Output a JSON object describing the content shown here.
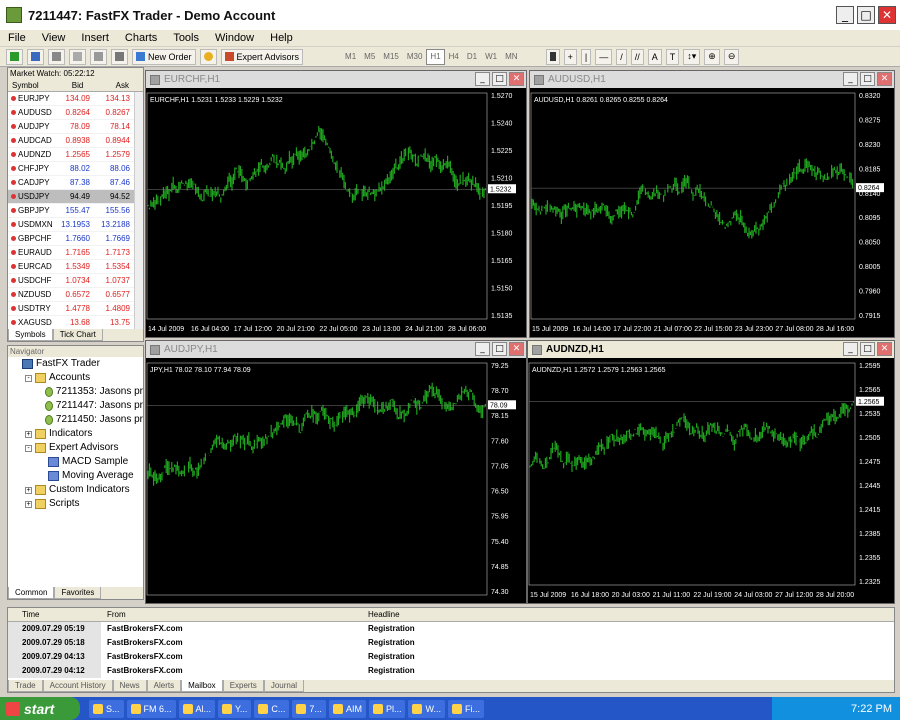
{
  "window": {
    "title": "7211447: FastFX Trader - Demo Account"
  },
  "menu": [
    "File",
    "View",
    "Insert",
    "Charts",
    "Tools",
    "Window",
    "Help"
  ],
  "toolbar": {
    "new_order": "New Order",
    "expert_advisors": "Expert Advisors",
    "timeframes": [
      "M1",
      "M5",
      "M15",
      "M30",
      "H1",
      "H4",
      "D1",
      "W1",
      "MN"
    ],
    "active_tf": "H1"
  },
  "market_watch": {
    "title": "Market Watch: 05:22:12",
    "columns": [
      "Symbol",
      "Bid",
      "Ask"
    ],
    "rows": [
      {
        "symbol": "EURJPY",
        "bid": "134.09",
        "ask": "134.13",
        "dir": "dn"
      },
      {
        "symbol": "AUDUSD",
        "bid": "0.8264",
        "ask": "0.8267",
        "dir": "dn"
      },
      {
        "symbol": "AUDJPY",
        "bid": "78.09",
        "ask": "78.14",
        "dir": "dn"
      },
      {
        "symbol": "AUDCAD",
        "bid": "0.8938",
        "ask": "0.8944",
        "dir": "dn"
      },
      {
        "symbol": "AUDNZD",
        "bid": "1.2565",
        "ask": "1.2579",
        "dir": "dn"
      },
      {
        "symbol": "CHFJPY",
        "bid": "88.02",
        "ask": "88.06",
        "dir": "up"
      },
      {
        "symbol": "CADJPY",
        "bid": "87.38",
        "ask": "87.46",
        "dir": "up"
      },
      {
        "symbol": "USDJPY",
        "bid": "94.49",
        "ask": "94.52",
        "dir": "sel"
      },
      {
        "symbol": "GBPJPY",
        "bid": "155.47",
        "ask": "155.56",
        "dir": "up"
      },
      {
        "symbol": "USDMXN",
        "bid": "13.1953",
        "ask": "13.2188",
        "dir": "up"
      },
      {
        "symbol": "GBPCHF",
        "bid": "1.7660",
        "ask": "1.7669",
        "dir": "up"
      },
      {
        "symbol": "EURAUD",
        "bid": "1.7165",
        "ask": "1.7173",
        "dir": "dn"
      },
      {
        "symbol": "EURCAD",
        "bid": "1.5349",
        "ask": "1.5354",
        "dir": "dn"
      },
      {
        "symbol": "USDCHF",
        "bid": "1.0734",
        "ask": "1.0737",
        "dir": "dn"
      },
      {
        "symbol": "NZDUSD",
        "bid": "0.6572",
        "ask": "0.6577",
        "dir": "dn"
      },
      {
        "symbol": "USDTRY",
        "bid": "1.4778",
        "ask": "1.4809",
        "dir": "dn"
      },
      {
        "symbol": "XAGUSD",
        "bid": "13.68",
        "ask": "13.75",
        "dir": "dn"
      }
    ],
    "tabs": [
      "Symbols",
      "Tick Chart"
    ]
  },
  "navigator": {
    "title": "Navigator",
    "items": [
      {
        "label": "FastFX Trader",
        "level": 0,
        "icon": "app-icon",
        "expand": ""
      },
      {
        "label": "Accounts",
        "level": 1,
        "icon": "folder-icon",
        "expand": "-"
      },
      {
        "label": "7211353: Jasons pr",
        "level": 2,
        "icon": "account-icon",
        "expand": ""
      },
      {
        "label": "7211447: Jasons pr",
        "level": 2,
        "icon": "account-icon",
        "expand": ""
      },
      {
        "label": "7211450: Jasons pr",
        "level": 2,
        "icon": "account-icon",
        "expand": ""
      },
      {
        "label": "Indicators",
        "level": 1,
        "icon": "folder-icon",
        "expand": "+"
      },
      {
        "label": "Expert Advisors",
        "level": 1,
        "icon": "folder-icon",
        "expand": "-"
      },
      {
        "label": "MACD Sample",
        "level": 2,
        "icon": "expert-icon",
        "expand": ""
      },
      {
        "label": "Moving Average",
        "level": 2,
        "icon": "expert-icon",
        "expand": ""
      },
      {
        "label": "Custom Indicators",
        "level": 1,
        "icon": "folder-icon",
        "expand": "+"
      },
      {
        "label": "Scripts",
        "level": 1,
        "icon": "folder-icon",
        "expand": "+"
      }
    ],
    "tabs": [
      "Common",
      "Favorites"
    ]
  },
  "charts": [
    {
      "title": "EURCHF,H1",
      "info": "EURCHF,H1  1.5231 1.5233 1.5229 1.5232",
      "price": "1.5232",
      "active": false,
      "yticks": [
        "1.5270",
        "1.5240",
        "1.5225",
        "1.5210",
        "1.5195",
        "1.5180",
        "1.5165",
        "1.5150",
        "1.5135"
      ],
      "xticks": [
        "14 Jul 2009",
        "16 Jul 04:00",
        "17 Jul 12:00",
        "20 Jul 21:00",
        "22 Jul 05:00",
        "23 Jul 13:00",
        "24 Jul 21:00",
        "28 Jul 06:00"
      ],
      "color": "#1fa31f",
      "seed": 3
    },
    {
      "title": "AUDUSD,H1",
      "info": "AUDUSD,H1  0.8261 0.8265 0.8255 0.8264",
      "price": "0.8264",
      "active": false,
      "yticks": [
        "0.8320",
        "0.8275",
        "0.8230",
        "0.8185",
        "0.8140",
        "0.8095",
        "0.8050",
        "0.8005",
        "0.7960",
        "0.7915"
      ],
      "xticks": [
        "15 Jul 2009",
        "16 Jul 14:00",
        "17 Jul 22:00",
        "21 Jul 07:00",
        "22 Jul 15:00",
        "23 Jul 23:00",
        "27 Jul 08:00",
        "28 Jul 16:00"
      ],
      "color": "#1fa31f",
      "seed": 7
    },
    {
      "title": "AUDJPY,H1",
      "info": "JPY,H1  78.02 78.10 77.94 78.09",
      "price": "78.09",
      "active": false,
      "yticks": [
        "79.25",
        "78.70",
        "78.15",
        "77.60",
        "77.05",
        "76.50",
        "75.95",
        "75.40",
        "74.85",
        "74.30"
      ],
      "xticks": [],
      "color": "#1fa31f",
      "seed": 11
    },
    {
      "title": "AUDNZD,H1",
      "info": "AUDNZD,H1  1.2572 1.2579 1.2563 1.2565",
      "price": "1.2565",
      "active": true,
      "yticks": [
        "1.2595",
        "1.2565",
        "1.2535",
        "1.2505",
        "1.2475",
        "1.2445",
        "1.2415",
        "1.2385",
        "1.2355",
        "1.2325"
      ],
      "xticks": [
        "15 Jul 2009",
        "16 Jul 18:00",
        "20 Jul 03:00",
        "21 Jul 11:00",
        "22 Jul 19:00",
        "24 Jul 03:00",
        "27 Jul 12:00",
        "28 Jul 20:00"
      ],
      "color": "#1fa31f",
      "seed": 19
    }
  ],
  "terminal": {
    "columns": [
      "Time",
      "From",
      "Headline"
    ],
    "rows": [
      {
        "time": "2009.07.29 05:19",
        "from": "FastBrokersFX.com",
        "headline": "Registration"
      },
      {
        "time": "2009.07.29 05:18",
        "from": "FastBrokersFX.com",
        "headline": "Registration"
      },
      {
        "time": "2009.07.29 04:13",
        "from": "FastBrokersFX.com",
        "headline": "Registration"
      },
      {
        "time": "2009.07.29 04:12",
        "from": "FastBrokersFX.com",
        "headline": "Registration"
      }
    ],
    "tabs": [
      "Trade",
      "Account History",
      "News",
      "Alerts",
      "Mailbox",
      "Experts",
      "Journal"
    ],
    "active_tab": "Mailbox"
  },
  "taskbar": {
    "start": "start",
    "tasks": [
      "S...",
      "FM 6...",
      "Al...",
      "Y...",
      "C...",
      "7...",
      "AIM",
      "Pl...",
      "W...",
      "Fi..."
    ],
    "clock": "7:22 PM"
  }
}
